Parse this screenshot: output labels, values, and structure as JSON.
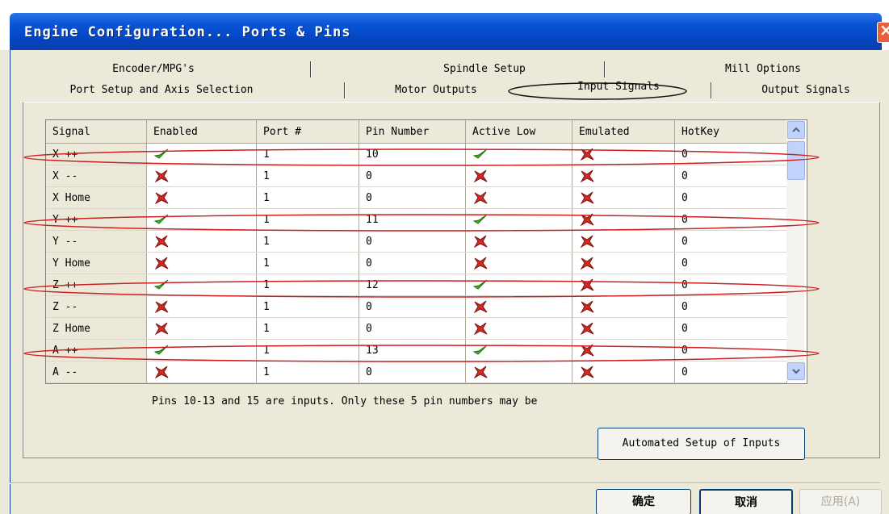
{
  "window": {
    "title": "Engine Configuration... Ports & Pins"
  },
  "tabs": {
    "back_row": [
      "Encoder/MPG's",
      "Spindle Setup",
      "Mill Options"
    ],
    "front_row": [
      "Port Setup and Axis Selection",
      "Motor Outputs",
      "Input Signals",
      "Output Signals"
    ],
    "active": "Input Signals"
  },
  "table": {
    "columns": [
      "Signal",
      "Enabled",
      "Port #",
      "Pin Number",
      "Active Low",
      "Emulated",
      "HotKey"
    ],
    "rows": [
      {
        "signal": "X ++",
        "enabled": true,
        "port": "1",
        "pin": "10",
        "active_low": true,
        "emulated": false,
        "hotkey": "0"
      },
      {
        "signal": "X --",
        "enabled": false,
        "port": "1",
        "pin": "0",
        "active_low": false,
        "emulated": false,
        "hotkey": "0"
      },
      {
        "signal": "X Home",
        "enabled": false,
        "port": "1",
        "pin": "0",
        "active_low": false,
        "emulated": false,
        "hotkey": "0"
      },
      {
        "signal": "Y ++",
        "enabled": true,
        "port": "1",
        "pin": "11",
        "active_low": true,
        "emulated": false,
        "hotkey": "0"
      },
      {
        "signal": "Y --",
        "enabled": false,
        "port": "1",
        "pin": "0",
        "active_low": false,
        "emulated": false,
        "hotkey": "0"
      },
      {
        "signal": "Y Home",
        "enabled": false,
        "port": "1",
        "pin": "0",
        "active_low": false,
        "emulated": false,
        "hotkey": "0"
      },
      {
        "signal": "Z ++",
        "enabled": true,
        "port": "1",
        "pin": "12",
        "active_low": true,
        "emulated": false,
        "hotkey": "0"
      },
      {
        "signal": "Z --",
        "enabled": false,
        "port": "1",
        "pin": "0",
        "active_low": false,
        "emulated": false,
        "hotkey": "0"
      },
      {
        "signal": "Z Home",
        "enabled": false,
        "port": "1",
        "pin": "0",
        "active_low": false,
        "emulated": false,
        "hotkey": "0"
      },
      {
        "signal": "A ++",
        "enabled": true,
        "port": "1",
        "pin": "13",
        "active_low": true,
        "emulated": false,
        "hotkey": "0"
      },
      {
        "signal": "A --",
        "enabled": false,
        "port": "1",
        "pin": "0",
        "active_low": false,
        "emulated": false,
        "hotkey": "0"
      }
    ]
  },
  "note": "Pins 10-13 and 15 are inputs. Only these 5 pin numbers may be",
  "buttons": {
    "automated": "Automated Setup of Inputs",
    "ok": "确定",
    "cancel": "取消",
    "apply": "应用(A)"
  },
  "colors": {
    "check": "#3fb61f",
    "cross": "#d42a1f",
    "annotation": "#cc1f1f",
    "title_bar": "#0a55d6"
  }
}
